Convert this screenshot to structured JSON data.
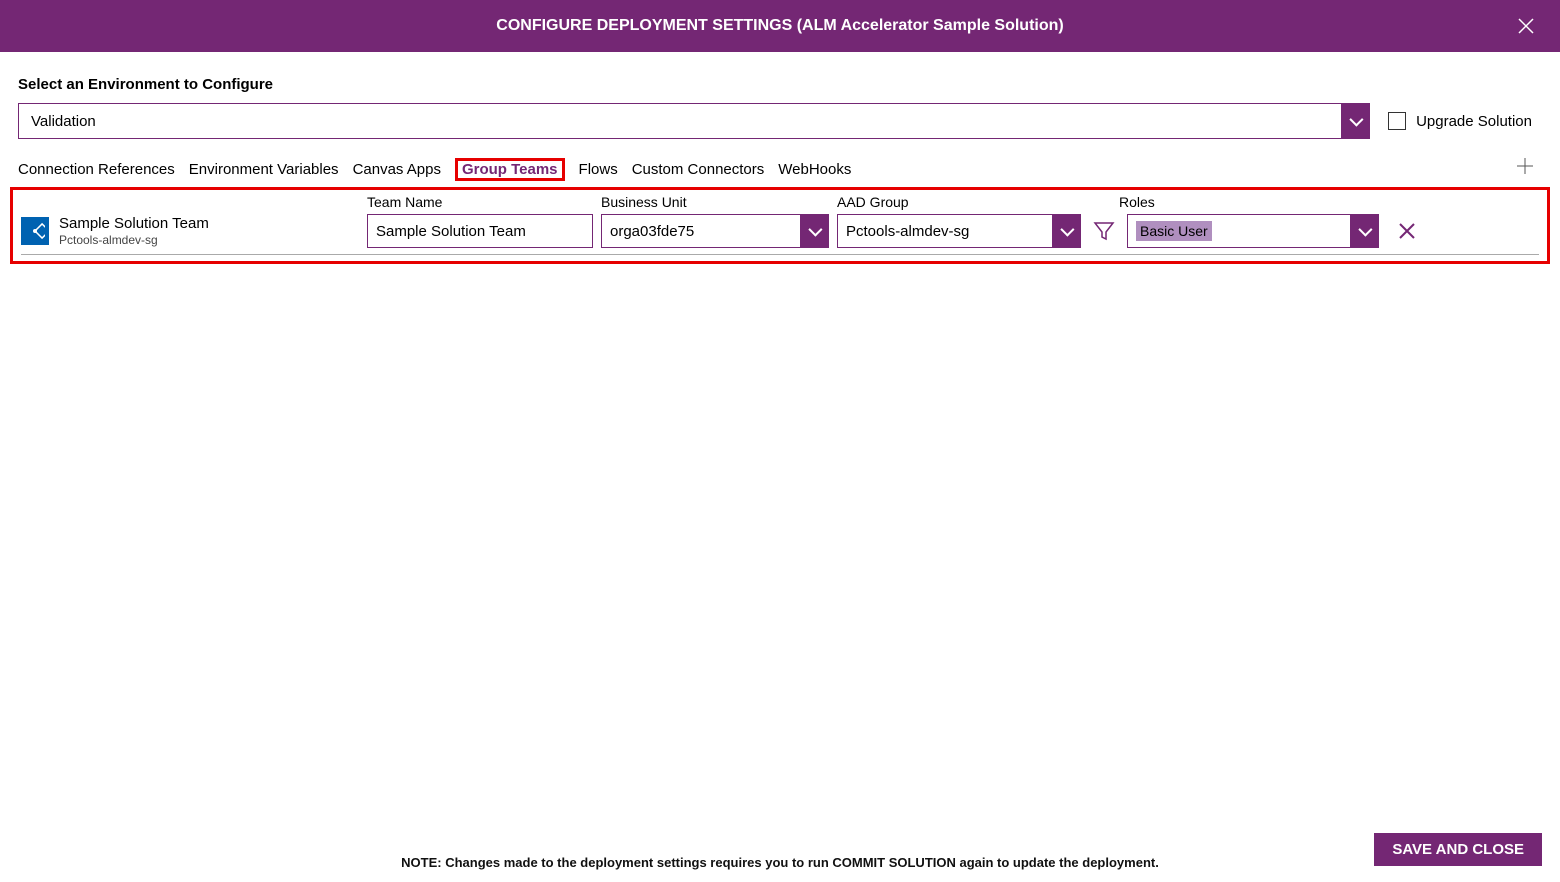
{
  "header": {
    "title": "CONFIGURE DEPLOYMENT SETTINGS (ALM Accelerator Sample Solution)"
  },
  "env": {
    "label": "Select an Environment to Configure",
    "value": "Validation",
    "upgrade_label": "Upgrade Solution"
  },
  "tabs": {
    "items": [
      "Connection References",
      "Environment Variables",
      "Canvas Apps",
      "Group Teams",
      "Flows",
      "Custom Connectors",
      "WebHooks"
    ],
    "active": "Group Teams"
  },
  "columns": {
    "team_name": "Team Name",
    "business_unit": "Business Unit",
    "aad_group": "AAD Group",
    "roles": "Roles"
  },
  "rows": [
    {
      "team_title": "Sample Solution Team",
      "team_sub": "Pctools-almdev-sg",
      "team_name_value": "Sample Solution Team",
      "business_unit_value": "orga03fde75",
      "aad_group_value": "Pctools-almdev-sg",
      "roles_value": "Basic User"
    }
  ],
  "footer": {
    "note": "NOTE: Changes made to the deployment settings requires you to run COMMIT SOLUTION again to update the deployment.",
    "save_label": "SAVE AND CLOSE"
  }
}
